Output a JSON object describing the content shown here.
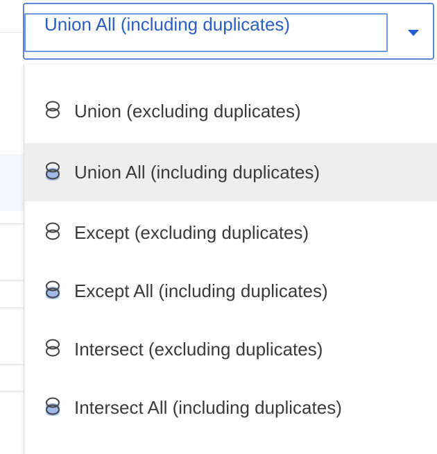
{
  "select": {
    "value": "Union All (including duplicates)",
    "arrow_icon": "caret-down-icon",
    "accent_color": "#2a5ec4"
  },
  "menu": {
    "items": [
      {
        "label": "Union (excluding duplicates)",
        "icon": "union-icon",
        "selected": false
      },
      {
        "label": "Union All (including duplicates)",
        "icon": "union-all-icon",
        "selected": true
      },
      {
        "label": "Except (excluding duplicates)",
        "icon": "except-icon",
        "selected": false
      },
      {
        "label": "Except All (including duplicates)",
        "icon": "except-all-icon",
        "selected": false
      },
      {
        "label": "Intersect (excluding duplicates)",
        "icon": "intersect-icon",
        "selected": false
      },
      {
        "label": "Intersect All (including duplicates)",
        "icon": "intersect-all-icon",
        "selected": false
      }
    ]
  },
  "colors": {
    "highlight_background": "#eeeeee",
    "icon_fill": "#9fb9e8"
  }
}
